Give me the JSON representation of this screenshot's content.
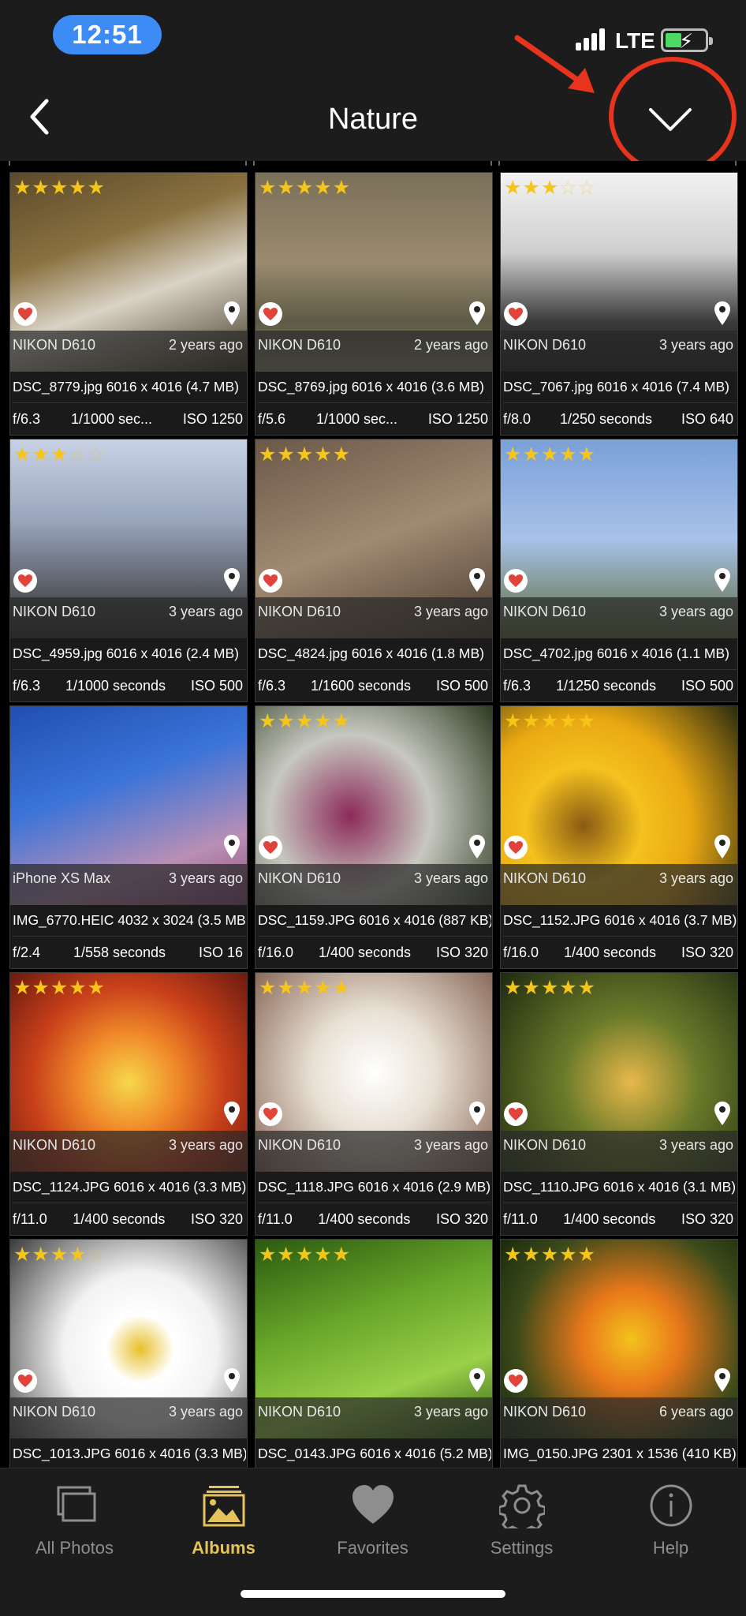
{
  "status": {
    "time": "12:51",
    "network": "LTE"
  },
  "nav": {
    "title": "Nature"
  },
  "photos": [
    {
      "stars": 5,
      "camera": "NIKON D610",
      "ago": "2 years ago",
      "file": "DSC_8779.jpg",
      "dims": "6016 x 4016 (4.7 MB)",
      "aperture": "f/6.3",
      "shutter": "1/1000 sec...",
      "iso": "ISO 1250",
      "favorite": true,
      "location": true
    },
    {
      "stars": 5,
      "camera": "NIKON D610",
      "ago": "2 years ago",
      "file": "DSC_8769.jpg",
      "dims": "6016 x 4016 (3.6 MB)",
      "aperture": "f/5.6",
      "shutter": "1/1000 sec...",
      "iso": "ISO 1250",
      "favorite": true,
      "location": true
    },
    {
      "stars": 3,
      "camera": "NIKON D610",
      "ago": "3 years ago",
      "file": "DSC_7067.jpg",
      "dims": "6016 x 4016 (7.4 MB)",
      "aperture": "f/8.0",
      "shutter": "1/250 seconds",
      "iso": "ISO 640",
      "favorite": true,
      "location": true
    },
    {
      "stars": 3,
      "camera": "NIKON D610",
      "ago": "3 years ago",
      "file": "DSC_4959.jpg",
      "dims": "6016 x 4016 (2.4 MB)",
      "aperture": "f/6.3",
      "shutter": "1/1000 seconds",
      "iso": "ISO 500",
      "favorite": true,
      "location": true
    },
    {
      "stars": 5,
      "camera": "NIKON D610",
      "ago": "3 years ago",
      "file": "DSC_4824.jpg",
      "dims": "6016 x 4016 (1.8 MB)",
      "aperture": "f/6.3",
      "shutter": "1/1600 seconds",
      "iso": "ISO 500",
      "favorite": true,
      "location": true
    },
    {
      "stars": 5,
      "camera": "NIKON D610",
      "ago": "3 years ago",
      "file": "DSC_4702.jpg",
      "dims": "6016 x 4016 (1.1 MB)",
      "aperture": "f/6.3",
      "shutter": "1/1250 seconds",
      "iso": "ISO 500",
      "favorite": true,
      "location": true
    },
    {
      "stars": 0,
      "camera": "iPhone XS Max",
      "ago": "3 years ago",
      "file": "IMG_6770.HEIC",
      "dims": "4032 x 3024 (3.5 MB)",
      "aperture": "f/2.4",
      "shutter": "1/558 seconds",
      "iso": "ISO 16",
      "favorite": false,
      "location": true
    },
    {
      "stars": 5,
      "camera": "NIKON D610",
      "ago": "3 years ago",
      "file": "DSC_1159.JPG",
      "dims": "6016 x 4016 (887 KB)",
      "aperture": "f/16.0",
      "shutter": "1/400 seconds",
      "iso": "ISO 320",
      "favorite": true,
      "location": true
    },
    {
      "stars": 5,
      "camera": "NIKON D610",
      "ago": "3 years ago",
      "file": "DSC_1152.JPG",
      "dims": "6016 x 4016 (3.7 MB)",
      "aperture": "f/16.0",
      "shutter": "1/400 seconds",
      "iso": "ISO 320",
      "favorite": true,
      "location": true
    },
    {
      "stars": 5,
      "camera": "NIKON D610",
      "ago": "3 years ago",
      "file": "DSC_1124.JPG",
      "dims": "6016 x 4016 (3.3 MB)",
      "aperture": "f/11.0",
      "shutter": "1/400 seconds",
      "iso": "ISO 320",
      "favorite": false,
      "location": true
    },
    {
      "stars": 5,
      "camera": "NIKON D610",
      "ago": "3 years ago",
      "file": "DSC_1118.JPG",
      "dims": "6016 x 4016 (2.9 MB)",
      "aperture": "f/11.0",
      "shutter": "1/400 seconds",
      "iso": "ISO 320",
      "favorite": true,
      "location": true
    },
    {
      "stars": 5,
      "camera": "NIKON D610",
      "ago": "3 years ago",
      "file": "DSC_1110.JPG",
      "dims": "6016 x 4016 (3.1 MB)",
      "aperture": "f/11.0",
      "shutter": "1/400 seconds",
      "iso": "ISO 320",
      "favorite": true,
      "location": true
    },
    {
      "stars": 4,
      "camera": "NIKON D610",
      "ago": "3 years ago",
      "file": "DSC_1013.JPG",
      "dims": "6016 x 4016 (3.3 MB)",
      "aperture": "",
      "shutter": "",
      "iso": "",
      "favorite": true,
      "location": true
    },
    {
      "stars": 5,
      "camera": "NIKON D610",
      "ago": "3 years ago",
      "file": "DSC_0143.JPG",
      "dims": "6016 x 4016 (5.2 MB)",
      "aperture": "",
      "shutter": "",
      "iso": "",
      "favorite": false,
      "location": true
    },
    {
      "stars": 5,
      "camera": "NIKON D610",
      "ago": "6 years ago",
      "file": "IMG_0150.JPG",
      "dims": "2301 x 1536 (410 KB)",
      "aperture": "",
      "shutter": "",
      "iso": "",
      "favorite": true,
      "location": true
    }
  ],
  "tabs": [
    {
      "label": "All Photos",
      "icon": "photos-icon",
      "active": false
    },
    {
      "label": "Albums",
      "icon": "albums-icon",
      "active": true
    },
    {
      "label": "Favorites",
      "icon": "heart-icon",
      "active": false
    },
    {
      "label": "Settings",
      "icon": "gear-icon",
      "active": false
    },
    {
      "label": "Help",
      "icon": "info-icon",
      "active": false
    }
  ],
  "colors": {
    "accent": "#e6c35a",
    "star": "#f5c518",
    "highlight": "#e8341c",
    "timePill": "#3d8bf5"
  }
}
